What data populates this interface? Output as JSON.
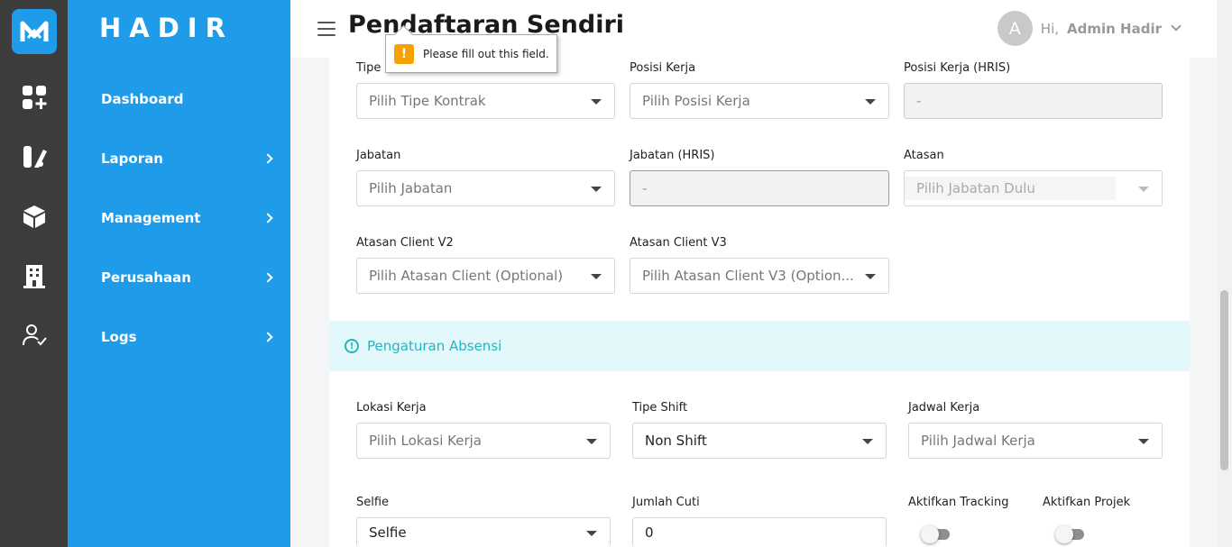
{
  "app": {
    "brand": "HADIR",
    "logo_icon": "hadir-logo-icon"
  },
  "rail": {
    "icons": [
      "dashboard-icon",
      "report-icon",
      "box-icon",
      "building-icon",
      "user-check-icon"
    ]
  },
  "sidebar": {
    "items": [
      {
        "label": "Dashboard",
        "has_children": false
      },
      {
        "label": "Laporan",
        "has_children": true
      },
      {
        "label": "Management",
        "has_children": true
      },
      {
        "label": "Perusahaan",
        "has_children": true
      },
      {
        "label": "Logs",
        "has_children": true
      }
    ]
  },
  "header": {
    "title": "Pendaftaran Sendiri",
    "avatar_letter": "A",
    "greeting": "Hi,",
    "user_name": "Admin Hadir"
  },
  "tooltip": {
    "message": "Please fill out this field."
  },
  "form": {
    "tipe_kontrak": {
      "label": "Tipe Kontrak",
      "placeholder": "Pilih Tipe Kontrak"
    },
    "posisi_kerja": {
      "label": "Posisi Kerja",
      "placeholder": "Pilih Posisi Kerja"
    },
    "posisi_kerja_hris": {
      "label": "Posisi Kerja (HRIS)",
      "value": "-"
    },
    "jabatan": {
      "label": "Jabatan",
      "placeholder": "Pilih Jabatan"
    },
    "jabatan_hris": {
      "label": "Jabatan (HRIS)",
      "value": "-"
    },
    "atasan": {
      "label": "Atasan",
      "placeholder": "Pilih Jabatan Dulu"
    },
    "atasan_client_v2": {
      "label": "Atasan Client V2",
      "placeholder": "Pilih Atasan Client (Optional)"
    },
    "atasan_client_v3": {
      "label": "Atasan Client V3",
      "placeholder": "Pilih Atasan Client V3 (Option..."
    },
    "section_absensi": {
      "title": "Pengaturan Absensi"
    },
    "lokasi_kerja": {
      "label": "Lokasi Kerja",
      "placeholder": "Pilih Lokasi Kerja"
    },
    "tipe_shift": {
      "label": "Tipe Shift",
      "value": "Non Shift"
    },
    "jadwal_kerja": {
      "label": "Jadwal Kerja",
      "placeholder": "Pilih Jadwal Kerja"
    },
    "selfie": {
      "label": "Selfie",
      "value": "Selfie"
    },
    "jumlah_cuti": {
      "label": "Jumlah Cuti",
      "value": "0"
    },
    "aktifkan_tracking": {
      "label": "Aktifkan Tracking",
      "enabled": false
    },
    "aktifkan_projek": {
      "label": "Aktifkan Projek",
      "enabled": false
    }
  }
}
